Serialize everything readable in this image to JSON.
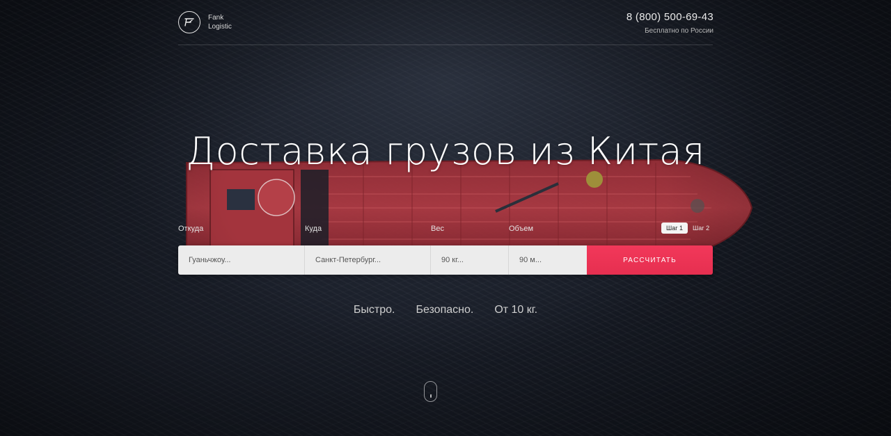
{
  "header": {
    "logo_line1": "Fank",
    "logo_line2": "Logistic",
    "phone": "8 (800) 500-69-43",
    "phone_note": "Бесплатно по России"
  },
  "hero": {
    "title": "Доставка грузов из Китая"
  },
  "form": {
    "labels": {
      "from": "Откуда",
      "to": "Куда",
      "weight": "Вес",
      "volume": "Объем"
    },
    "steps": [
      "Шаг 1",
      "Шаг 2"
    ],
    "active_step": "Шаг 1",
    "fields": {
      "from_value": "Гуаньчжоу...",
      "to_value": "Санкт-Петербург...",
      "weight_value": "90 кг...",
      "volume_value": "90 м..."
    },
    "submit_label": "РАССЧИТАТЬ"
  },
  "tagline": {
    "item1": "Быстро.",
    "item2": "Безопасно.",
    "item3": "От 10 кг."
  },
  "colors": {
    "accent": "#f2385a",
    "background": "#141821",
    "ship_hull": "#a8333c"
  },
  "icons": {
    "logo": "logo-mark-icon",
    "scroll": "scroll-mouse-icon"
  }
}
